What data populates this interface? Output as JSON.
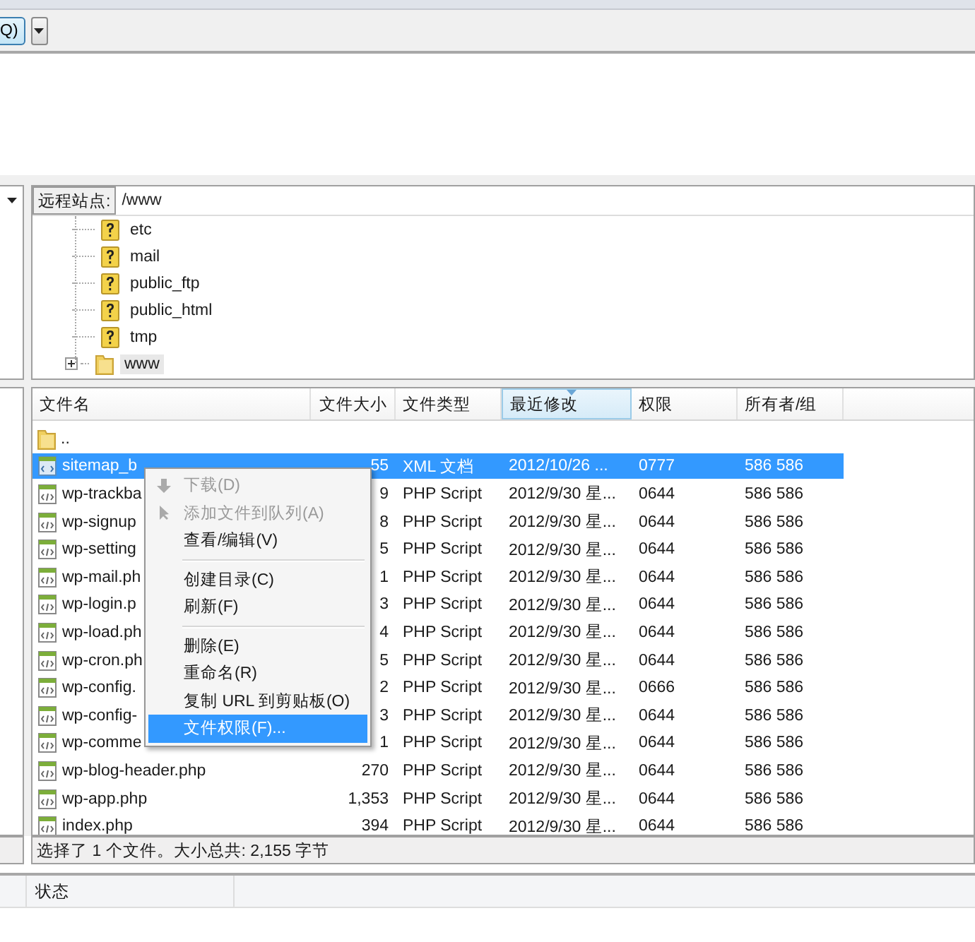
{
  "toolbar": {
    "button": "Q)"
  },
  "remote_site": {
    "label": "远程站点:",
    "path": "/www"
  },
  "tree": [
    {
      "name": "etc",
      "kind": "unknown",
      "selected": false
    },
    {
      "name": "mail",
      "kind": "unknown",
      "selected": false
    },
    {
      "name": "public_ftp",
      "kind": "unknown",
      "selected": false
    },
    {
      "name": "public_html",
      "kind": "unknown",
      "selected": false
    },
    {
      "name": "tmp",
      "kind": "unknown",
      "selected": false
    },
    {
      "name": "www",
      "kind": "folder",
      "selected": true
    }
  ],
  "file_list": {
    "columns": [
      {
        "label": "文件名",
        "sorted": false
      },
      {
        "label": "文件大小",
        "sorted": false
      },
      {
        "label": "文件类型",
        "sorted": false
      },
      {
        "label": "最近修改",
        "sorted": true
      },
      {
        "label": "权限",
        "sorted": false
      },
      {
        "label": "所有者/组",
        "sorted": false
      }
    ],
    "rows": [
      {
        "kind": "folder",
        "name": "..",
        "selected": false
      },
      {
        "kind": "xml",
        "name": "sitemap_b",
        "size": "55",
        "type": "XML 文档",
        "modified": "2012/10/26 ...",
        "permissions": "0777",
        "owner": "586 586",
        "selected": true
      },
      {
        "kind": "php",
        "name": "wp-trackba",
        "size": "9",
        "type": "PHP Script",
        "modified": "2012/9/30 星...",
        "permissions": "0644",
        "owner": "586 586",
        "selected": false
      },
      {
        "kind": "php",
        "name": "wp-signup",
        "size": "8",
        "type": "PHP Script",
        "modified": "2012/9/30 星...",
        "permissions": "0644",
        "owner": "586 586",
        "selected": false
      },
      {
        "kind": "php",
        "name": "wp-setting",
        "size": "5",
        "type": "PHP Script",
        "modified": "2012/9/30 星...",
        "permissions": "0644",
        "owner": "586 586",
        "selected": false
      },
      {
        "kind": "php",
        "name": "wp-mail.ph",
        "size": "1",
        "type": "PHP Script",
        "modified": "2012/9/30 星...",
        "permissions": "0644",
        "owner": "586 586",
        "selected": false
      },
      {
        "kind": "php",
        "name": "wp-login.p",
        "size": "3",
        "type": "PHP Script",
        "modified": "2012/9/30 星...",
        "permissions": "0644",
        "owner": "586 586",
        "selected": false
      },
      {
        "kind": "php",
        "name": "wp-load.ph",
        "size": "4",
        "type": "PHP Script",
        "modified": "2012/9/30 星...",
        "permissions": "0644",
        "owner": "586 586",
        "selected": false
      },
      {
        "kind": "php",
        "name": "wp-cron.ph",
        "size": "5",
        "type": "PHP Script",
        "modified": "2012/9/30 星...",
        "permissions": "0644",
        "owner": "586 586",
        "selected": false
      },
      {
        "kind": "php",
        "name": "wp-config.",
        "size": "2",
        "type": "PHP Script",
        "modified": "2012/9/30 星...",
        "permissions": "0666",
        "owner": "586 586",
        "selected": false
      },
      {
        "kind": "php",
        "name": "wp-config-",
        "size": "3",
        "type": "PHP Script",
        "modified": "2012/9/30 星...",
        "permissions": "0644",
        "owner": "586 586",
        "selected": false
      },
      {
        "kind": "php",
        "name": "wp-comme",
        "size": "1",
        "type": "PHP Script",
        "modified": "2012/9/30 星...",
        "permissions": "0644",
        "owner": "586 586",
        "selected": false
      },
      {
        "kind": "php",
        "name": "wp-blog-header.php",
        "size": "270",
        "type": "PHP Script",
        "modified": "2012/9/30 星...",
        "permissions": "0644",
        "owner": "586 586",
        "selected": false
      },
      {
        "kind": "php",
        "name": "wp-app.php",
        "size": "1,353",
        "type": "PHP Script",
        "modified": "2012/9/30 星...",
        "permissions": "0644",
        "owner": "586 586",
        "selected": false
      },
      {
        "kind": "php",
        "name": "index.php",
        "size": "394",
        "type": "PHP Script",
        "modified": "2012/9/30 星...",
        "permissions": "0644",
        "owner": "586 586",
        "selected": false
      }
    ]
  },
  "context_menu": [
    {
      "kind": "download",
      "label": "下载(D)",
      "disabled": true,
      "selected": false
    },
    {
      "kind": "enqueue",
      "label": "添加文件到队列(A)",
      "disabled": true,
      "selected": false
    },
    {
      "kind": "item",
      "label": "查看/编辑(V)",
      "disabled": false,
      "selected": false
    },
    {
      "kind": "separator"
    },
    {
      "kind": "item",
      "label": "创建目录(C)",
      "disabled": false,
      "selected": false
    },
    {
      "kind": "item",
      "label": "刷新(F)",
      "disabled": false,
      "selected": false
    },
    {
      "kind": "separator"
    },
    {
      "kind": "item",
      "label": "删除(E)",
      "disabled": false,
      "selected": false
    },
    {
      "kind": "item",
      "label": "重命名(R)",
      "disabled": false,
      "selected": false
    },
    {
      "kind": "item",
      "label": "复制 URL 到剪贴板(O)",
      "disabled": false,
      "selected": false
    },
    {
      "kind": "item",
      "label": "文件权限(F)...",
      "disabled": false,
      "selected": true
    }
  ],
  "status_bar": "选择了 1 个文件。大小总共: 2,155 字节",
  "queue": {
    "columns": [
      "状态"
    ]
  }
}
